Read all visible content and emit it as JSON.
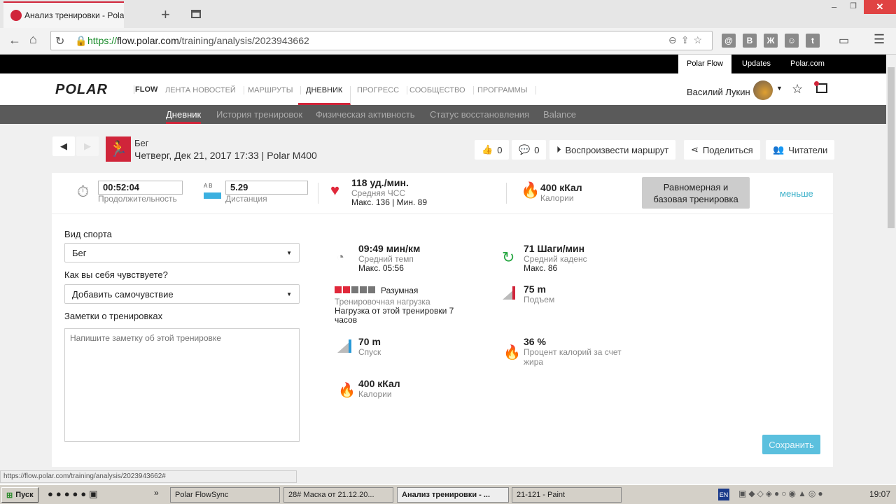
{
  "browser": {
    "tab_title": "Анализ тренировки - Polar Flow",
    "url_scheme": "https",
    "url_host": "flow.polar.com",
    "url_path": "/training/analysis/2023943662",
    "status_url": "https://flow.polar.com/training/analysis/2023943662#"
  },
  "topbar": {
    "links": [
      "Polar Flow",
      "Updates",
      "Polar.com"
    ]
  },
  "nav": {
    "logo": "POLAR",
    "flow": "FLOW",
    "items": [
      "ЛЕНТА НОВОСТЕЙ",
      "МАРШРУТЫ",
      "ДНЕВНИК",
      "ПРОГРЕСС",
      "СООБЩЕСТВО",
      "ПРОГРАММЫ"
    ],
    "user": "Василий Лукин"
  },
  "subnav": [
    "Дневник",
    "История тренировок",
    "Физическая активность",
    "Статус восстановления",
    "Balance"
  ],
  "session": {
    "sport": "Бег",
    "details": "Четверг, Дек 21, 2017 17:33 | Polar M400"
  },
  "actions": {
    "likes": "0",
    "comments": "0",
    "replay": "Воспроизвести маршрут",
    "share": "Поделиться",
    "readers": "Читатели"
  },
  "summary": {
    "duration": "00:52:04",
    "duration_label": "Продолжительность",
    "ab": "A  B",
    "distance": "5.29",
    "distance_label": "Дистанция",
    "hr": "118 уд./мин.",
    "hr_label": "Средняя ЧСС",
    "hr_minmax": "Макс. 136  |  Мин. 89",
    "calories": "400 кКал",
    "calories_label": "Калории",
    "benefit": "Равномерная и базовая тренировка",
    "less": "меньше"
  },
  "form": {
    "sport_label": "Вид спорта",
    "sport_value": "Бег",
    "feel_label": "Как вы себя чувствуете?",
    "feel_value": "Добавить самочувствие",
    "notes_label": "Заметки о тренировках",
    "notes_placeholder": "Напишите заметку об этой тренировке",
    "save": "Сохранить"
  },
  "stats": {
    "pace": "09:49 мин/км",
    "pace_label": "Средний темп",
    "pace_max": "Макс. 05:56",
    "cadence": "71 Шаги/мин",
    "cadence_label": "Средний каденс",
    "cadence_max": "Макс. 86",
    "load": "Разумная",
    "load_label": "Тренировочная нагрузка",
    "load_desc": "Нагрузка от этой тренировки 7 часов",
    "load_level": 2,
    "load_max": 5,
    "ascent": "75 m",
    "ascent_label": "Подъем",
    "descent": "70 m",
    "descent_label": "Спуск",
    "fat": "36 %",
    "fat_label": "Процент калорий за счет жира",
    "kcal": "400 кКал",
    "kcal_label": "Калории"
  },
  "taskbar": {
    "start": "Пуск",
    "items": [
      "Polar FlowSync",
      "28# Маска от 21.12.20...",
      "Анализ тренировки - ...",
      "21-121 - Paint"
    ],
    "lang": "EN",
    "time": "19:07"
  },
  "colors": {
    "accent": "#d0253a",
    "link": "#3bb0c9"
  }
}
